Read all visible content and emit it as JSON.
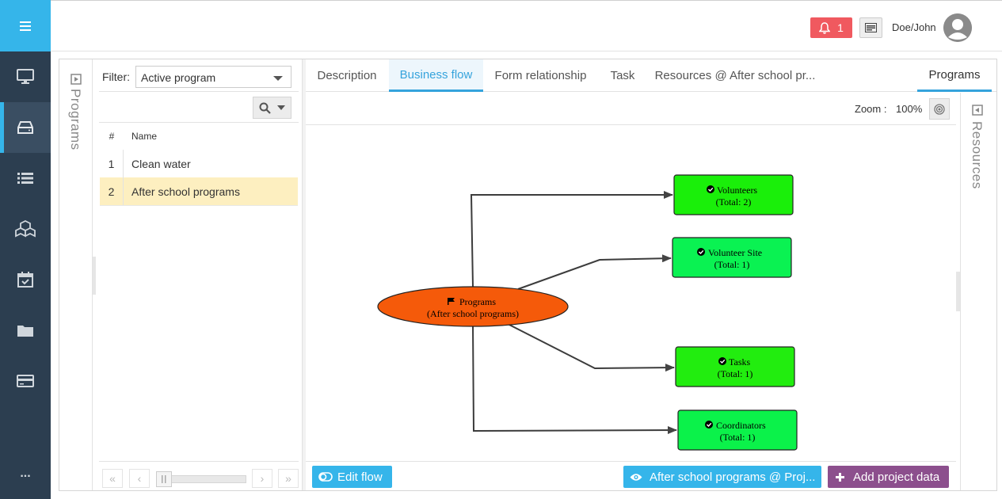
{
  "header": {
    "notification_count": "1",
    "username": "Doe/John"
  },
  "leftnav": {
    "items": [
      "monitor-icon",
      "inbox-icon",
      "list-icon",
      "cubes-icon",
      "calendar-check-icon",
      "folder-icon",
      "credit-card-icon"
    ],
    "more_label": "..."
  },
  "programs_rail": {
    "label": "Programs"
  },
  "resources_rail": {
    "label": "Resources"
  },
  "filter": {
    "label": "Filter:",
    "value": "Active program"
  },
  "table": {
    "headers": {
      "num": "#",
      "name": "Name"
    },
    "rows": [
      {
        "num": "1",
        "name": "Clean water",
        "selected": false
      },
      {
        "num": "2",
        "name": "After school programs",
        "selected": true
      }
    ]
  },
  "tabs": {
    "description": "Description",
    "business_flow": "Business flow",
    "form_relationship": "Form relationship",
    "task": "Task",
    "resources": "Resources @ After school pr...",
    "programs": "Programs"
  },
  "zoom": {
    "label": "Zoom :",
    "value": "100%"
  },
  "flow": {
    "root": {
      "line1": "Programs",
      "line2": "(After school programs)",
      "color": "#f55a0a"
    },
    "nodes": [
      {
        "line1": "Volunteers",
        "line2": "(Total: 2)",
        "color": "#1aef0a"
      },
      {
        "line1": "Volunteer Site",
        "line2": "(Total: 1)",
        "color": "#0af252"
      },
      {
        "line1": "Tasks",
        "line2": "(Total: 1)",
        "color": "#22ed0f"
      },
      {
        "line1": "Coordinators",
        "line2": "(Total: 1)",
        "color": "#0bf24a"
      }
    ]
  },
  "actions": {
    "edit_flow": "Edit flow",
    "view_program": "After school programs @ Proj...",
    "add_project_data": "Add project data"
  },
  "colors": {
    "accent": "#35b5ea",
    "nav_bg": "#2c3e50",
    "alert": "#f0595f",
    "purple": "#8c4f8d",
    "selected_row": "#fdefc0"
  }
}
